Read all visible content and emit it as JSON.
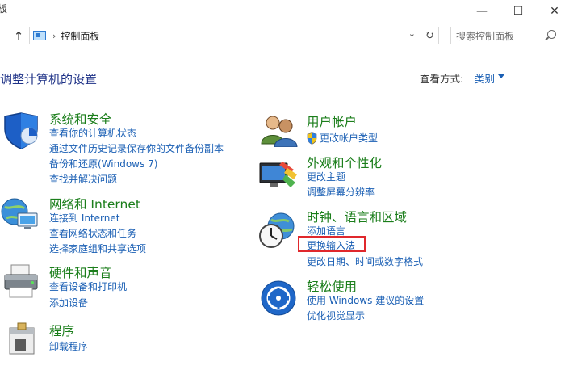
{
  "window": {
    "title_fragment": "板",
    "minimize": "—",
    "maximize": "☐",
    "close": "✕"
  },
  "address": {
    "crumb": "控制面板",
    "separator": "›",
    "dropdown": "⌄",
    "refresh": "↻"
  },
  "search": {
    "placeholder": "搜索控制面板"
  },
  "nav": {
    "up": "↑"
  },
  "page": {
    "heading": "调整计算机的设置",
    "view_label": "查看方式:",
    "view_value": "类别"
  },
  "categories": {
    "system": {
      "title": "系统和安全",
      "links": [
        "查看你的计算机状态",
        "通过文件历史记录保存你的文件备份副本",
        "备份和还原(Windows 7)",
        "查找并解决问题"
      ]
    },
    "network": {
      "title": "网络和 Internet",
      "links": [
        "连接到 Internet",
        "查看网络状态和任务",
        "选择家庭组和共享选项"
      ]
    },
    "hardware": {
      "title": "硬件和声音",
      "links": [
        "查看设备和打印机",
        "添加设备"
      ]
    },
    "programs": {
      "title": "程序",
      "links": [
        "卸载程序"
      ]
    },
    "users": {
      "title": "用户帐户",
      "links": [
        "更改帐户类型"
      ]
    },
    "appearance": {
      "title": "外观和个性化",
      "links": [
        "更改主题",
        "调整屏幕分辨率"
      ]
    },
    "clock": {
      "title": "时钟、语言和区域",
      "links": [
        "添加语言",
        "更换输入法",
        "更改日期、时间或数字格式"
      ]
    },
    "ease": {
      "title": "轻松使用",
      "links": [
        "使用 Windows 建议的设置",
        "优化视觉显示"
      ]
    }
  },
  "colors": {
    "category_title": "#1b7e1b",
    "link": "#1a5fb4",
    "highlight": "#e0282c"
  }
}
